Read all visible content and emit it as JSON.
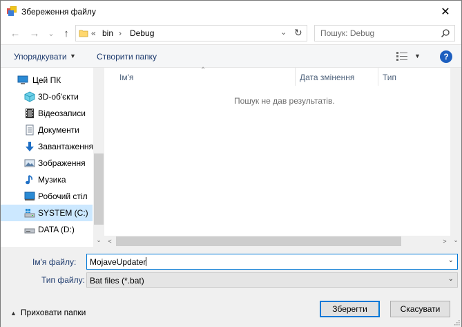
{
  "window": {
    "title": "Збереження файлу",
    "close_glyph": "✕"
  },
  "nav": {
    "back_glyph": "←",
    "forward_glyph": "→",
    "recent_glyph": "⌄",
    "up_glyph": "↑",
    "breadcrumb_overflow": "«",
    "breadcrumb": [
      "bin",
      "Debug"
    ],
    "breadcrumb_sep": "›",
    "dropdown_glyph": "⌄",
    "refresh_glyph": "↻",
    "search_placeholder": "Пошук: Debug"
  },
  "toolbar": {
    "organize_label": "Упорядкувати",
    "new_folder_label": "Створити папку",
    "dropdown_glyph": "▼",
    "help_label": "?"
  },
  "tree": {
    "items": [
      {
        "label": "Цей ПК",
        "icon": "computer-icon"
      },
      {
        "label": "3D-об'єкти",
        "icon": "3d-objects-icon"
      },
      {
        "label": "Відеозаписи",
        "icon": "video-icon"
      },
      {
        "label": "Документи",
        "icon": "documents-icon"
      },
      {
        "label": "Завантаження",
        "icon": "downloads-icon"
      },
      {
        "label": "Зображення",
        "icon": "pictures-icon"
      },
      {
        "label": "Музика",
        "icon": "music-icon"
      },
      {
        "label": "Робочий стіл",
        "icon": "desktop-icon"
      },
      {
        "label": "SYSTEM (C:)",
        "icon": "system-drive-icon",
        "selected": true
      },
      {
        "label": "DATA (D:)",
        "icon": "drive-icon"
      }
    ],
    "scroll_down_glyph": "⌄"
  },
  "list": {
    "columns": [
      "Ім'я",
      "Дата змінення",
      "Тип"
    ],
    "sort_glyph": "^",
    "empty_message": "Пошук не дав результатів.",
    "scroll_left_glyph": "<",
    "scroll_right_glyph": ">",
    "scroll_down_glyph": "⌄"
  },
  "form": {
    "filename_label": "Ім'я файлу:",
    "filename_value": "MojaveUpdater",
    "filetype_label": "Тип файлу:",
    "filetype_value": "Bat files (*.bat)",
    "dropdown_glyph": "⌄"
  },
  "footer": {
    "hide_folders_glyph": "▲",
    "hide_folders_label": "Приховати папки",
    "save_label": "Зберегти",
    "cancel_label": "Скасувати"
  }
}
